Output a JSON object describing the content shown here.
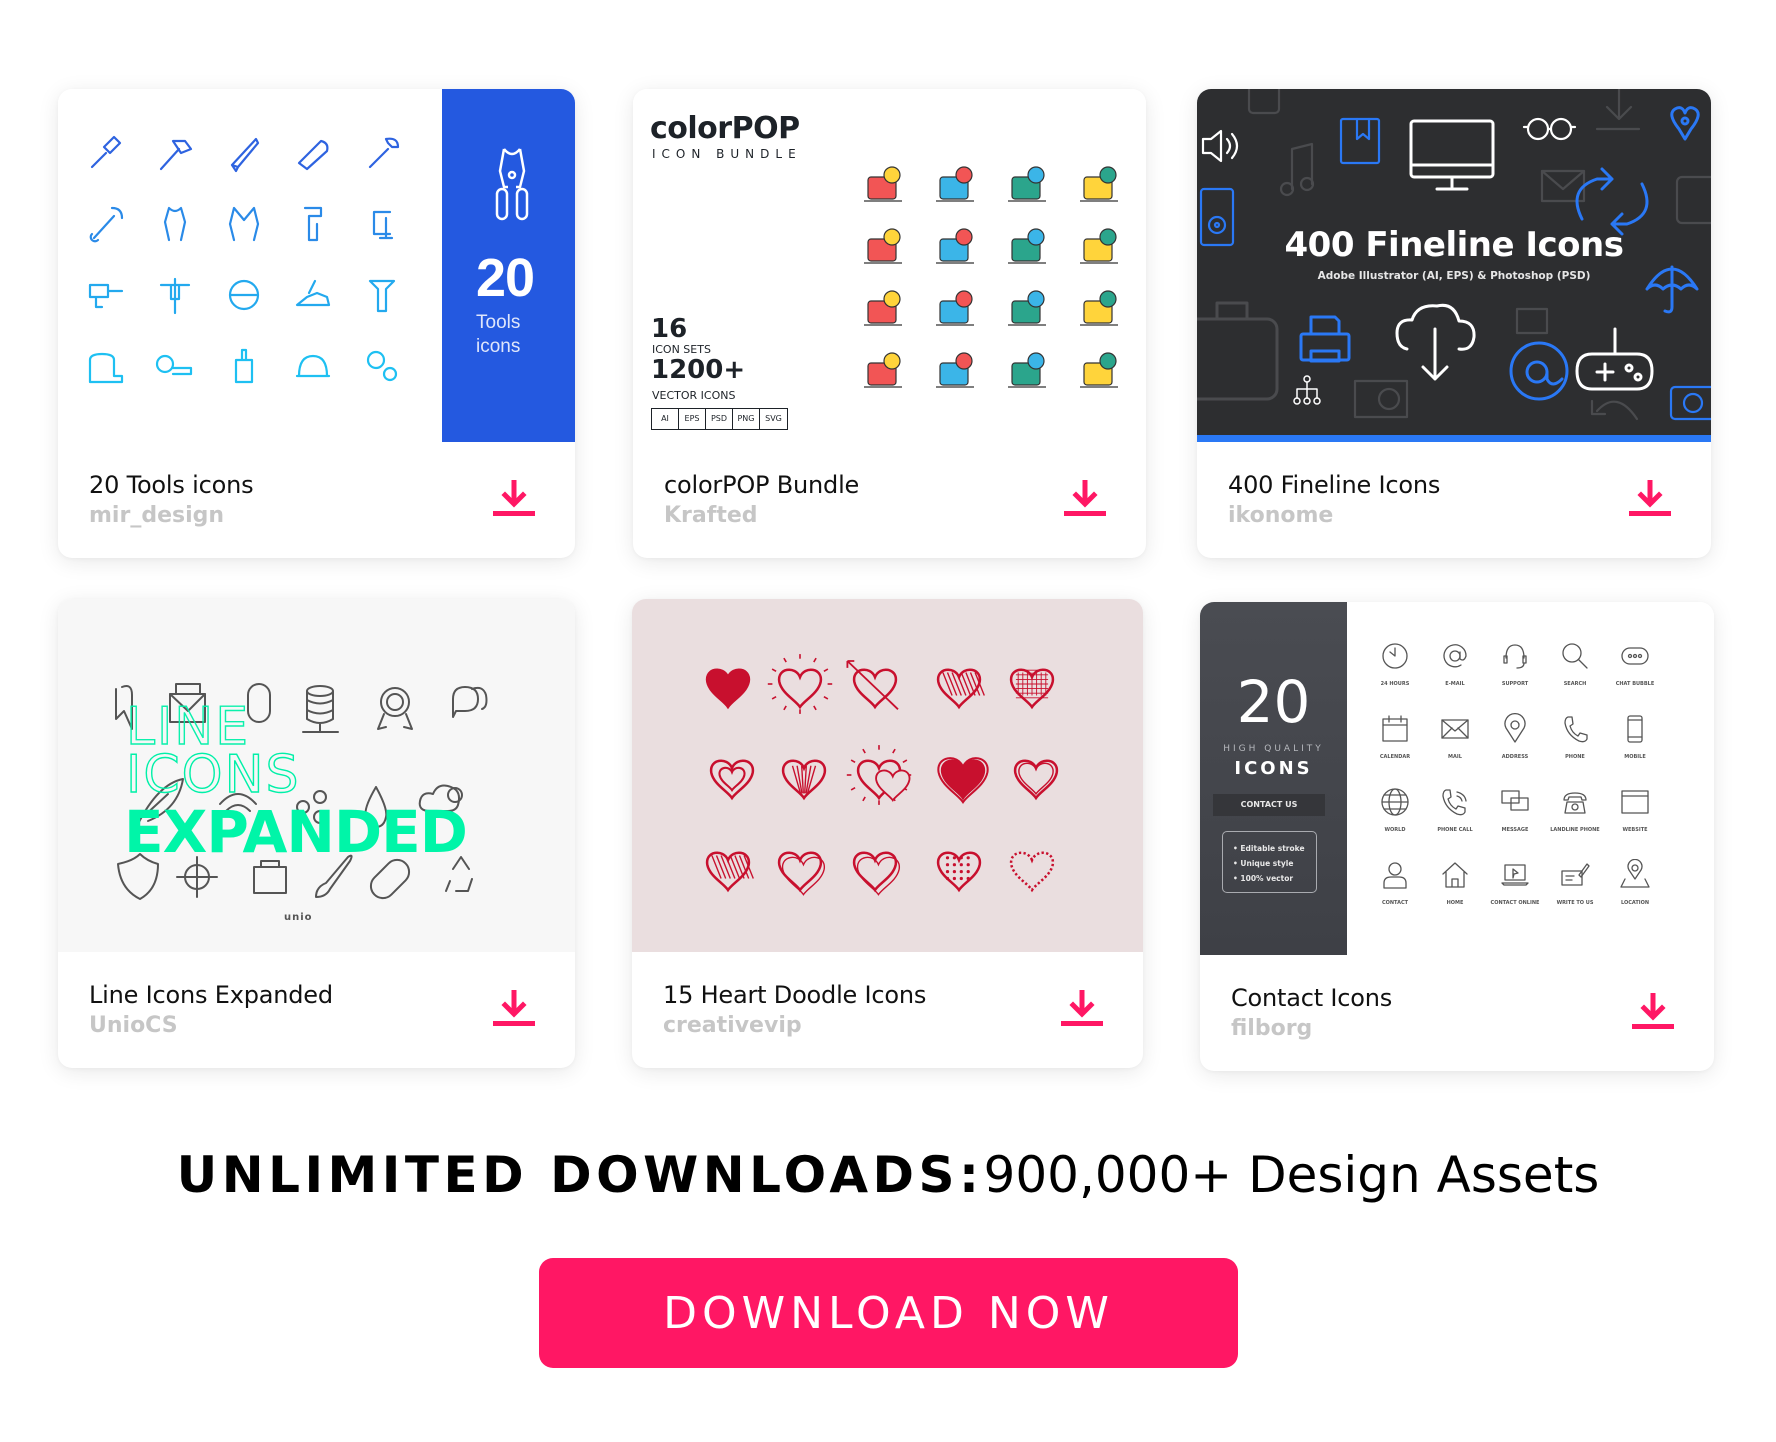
{
  "accent_color": "#FF1764",
  "cards": [
    {
      "title": "20 Tools icons",
      "author": "mir_design",
      "download_icon": "download-icon",
      "thumbnail": {
        "panel_color": "#2459E0",
        "big_number": "20",
        "panel_text": "Tools icons",
        "icons": [
          "screwdriver-icon",
          "hammer-icon",
          "handsaw-icon",
          "hacksaw-icon",
          "adjustable-wrench-icon",
          "wrench-icon",
          "pliers-icon",
          "wire-stripper-icon",
          "pipe-wrench-icon",
          "c-clamp-icon",
          "drill-icon",
          "jackhammer-icon",
          "circular-saw-icon",
          "hand-plane-icon",
          "screw-icon",
          "tape-measure-icon",
          "measuring-tape-icon",
          "paintbrush-icon",
          "hard-hat-icon",
          "gears-icon"
        ]
      }
    },
    {
      "title": "colorPOP Bundle",
      "author": "Krafted",
      "download_icon": "download-icon",
      "thumbnail": {
        "brand": "colorPOP",
        "brand_sub": "ICON BUNDLE",
        "stat1_value": "16",
        "stat1_label": "ICON SETS",
        "stat2_value": "1200+",
        "stat2_label": "VECTOR ICONS",
        "formats": [
          "AI",
          "EPS",
          "PSD",
          "PNG",
          "SVG"
        ]
      }
    },
    {
      "title": "400 Fineline Icons",
      "author": "ikonome",
      "download_icon": "download-icon",
      "thumbnail": {
        "headline": "400 Fineline Icons",
        "subline": "Adobe Illustrator (AI, EPS) & Photoshop (PSD)",
        "bg_color": "#2D2E30",
        "accent": "#2A78F5"
      }
    },
    {
      "title": "Line Icons Expanded",
      "author": "UnioCS",
      "download_icon": "download-icon",
      "thumbnail": {
        "word1": "LINE",
        "word2": "ICONS",
        "word3": "EXPANDED",
        "logo": "unio",
        "accent": "#00F5A8"
      }
    },
    {
      "title": "15 Heart Doodle Icons",
      "author": "creativevip",
      "download_icon": "download-icon",
      "thumbnail": {
        "bg_color": "#EADEDF",
        "heart_color": "#C8102E"
      }
    },
    {
      "title": "Contact Icons",
      "author": "filborg",
      "download_icon": "download-icon",
      "thumbnail": {
        "big_number": "20",
        "quality_label": "HIGH QUALITY",
        "icons_label": "ICONS",
        "ribbon": "CONTACT US",
        "features": [
          "• Editable stroke",
          "• Unique style",
          "• 100% vector"
        ],
        "icon_labels": [
          "24 HOURS",
          "E-MAIL",
          "SUPPORT",
          "SEARCH",
          "CHAT BUBBLE",
          "CALENDAR",
          "MAIL",
          "ADDRESS",
          "PHONE",
          "MOBILE",
          "WORLD",
          "PHONE CALL",
          "MESSAGE",
          "LANDLINE PHONE",
          "WEBSITE",
          "CONTACT",
          "HOME",
          "CONTACT ONLINE",
          "WRITE TO US",
          "LOCATION"
        ]
      }
    }
  ],
  "footer": {
    "headline_bold": "UNLIMITED DOWNLOADS:",
    "headline_regular": "900,000+ Design Assets",
    "cta_label": "DOWNLOAD NOW"
  }
}
